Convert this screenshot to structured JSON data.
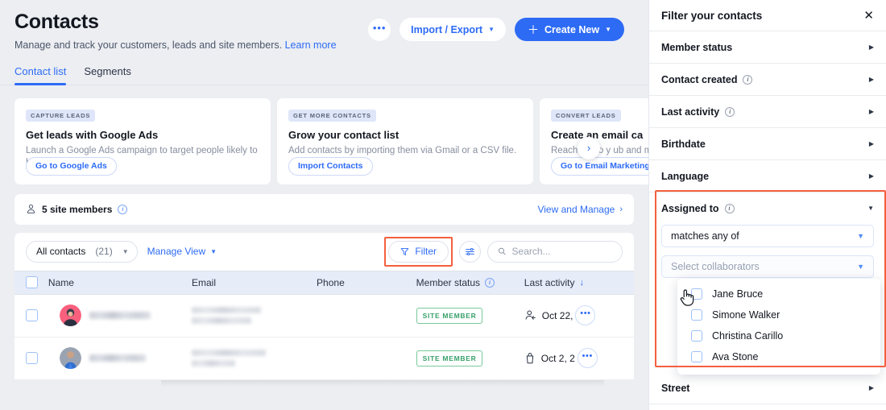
{
  "header": {
    "title": "Contacts",
    "subtitle": "Manage and track your customers, leads and site members.",
    "learn_more": "Learn more",
    "more_label": "•••",
    "import_export": "Import / Export",
    "create_new": "Create New"
  },
  "tabs": [
    {
      "label": "Contact list",
      "active": true
    },
    {
      "label": "Segments",
      "active": false
    }
  ],
  "promos": [
    {
      "tag": "CAPTURE LEADS",
      "title": "Get leads with Google Ads",
      "desc": "Launch a Google Ads campaign to target people likely to become leads.",
      "button": "Go to Google Ads"
    },
    {
      "tag": "GET MORE CONTACTS",
      "title": "Grow your contact list",
      "desc": "Add contacts by importing them via Gmail or a CSV file.",
      "button": "Import Contacts"
    },
    {
      "tag": "CONVERT LEADS",
      "title": "Create an email ca",
      "desc": "Reach out to y              ub and more.",
      "button": "Go to Email Marketing"
    }
  ],
  "members_strip": {
    "count_text": "5 site members",
    "link": "View and Manage"
  },
  "toolbar": {
    "view_name": "All contacts",
    "view_count": "(21)",
    "manage_view": "Manage View",
    "filter": "Filter",
    "search_placeholder": "Search...",
    "search_value": ""
  },
  "table": {
    "columns": [
      "Name",
      "Email",
      "Phone",
      "Member status",
      "Last activity"
    ],
    "sort_column": "Last activity",
    "sort_direction": "desc",
    "rows": [
      {
        "name": "",
        "email": "",
        "phone": "",
        "status": "SITE MEMBER",
        "activity": "Oct 22,",
        "activity_icon": "member-add-icon",
        "avatar_color": "#f8607d"
      },
      {
        "name": "",
        "email": "",
        "phone": "",
        "status": "SITE MEMBER",
        "activity": "Oct 2, 2",
        "activity_icon": "bag-icon",
        "avatar_color": "#8e97a8"
      }
    ]
  },
  "panel": {
    "title": "Filter your contacts",
    "close": "✕",
    "rows": [
      {
        "label": "Member status",
        "info": false
      },
      {
        "label": "Contact created",
        "info": true
      },
      {
        "label": "Last activity",
        "info": true
      },
      {
        "label": "Birthdate",
        "info": false
      },
      {
        "label": "Language",
        "info": false
      }
    ],
    "assigned_to": {
      "label": "Assigned to",
      "condition": "matches any of",
      "collaborators_placeholder": "Select collaborators",
      "options": [
        {
          "label": "Jane Bruce",
          "checked": false
        },
        {
          "label": "Simone Walker",
          "checked": false
        },
        {
          "label": "Christina Carillo",
          "checked": false
        },
        {
          "label": "Ava Stone",
          "checked": false
        }
      ]
    },
    "rows_after": [
      {
        "label": "Street",
        "info": false
      }
    ]
  },
  "colors": {
    "accent": "#2d6bf5",
    "highlight": "#f4603f",
    "badge_green": "#37a06a",
    "page_bg": "#eceef2",
    "table_header_bg": "#e6ecf8"
  }
}
